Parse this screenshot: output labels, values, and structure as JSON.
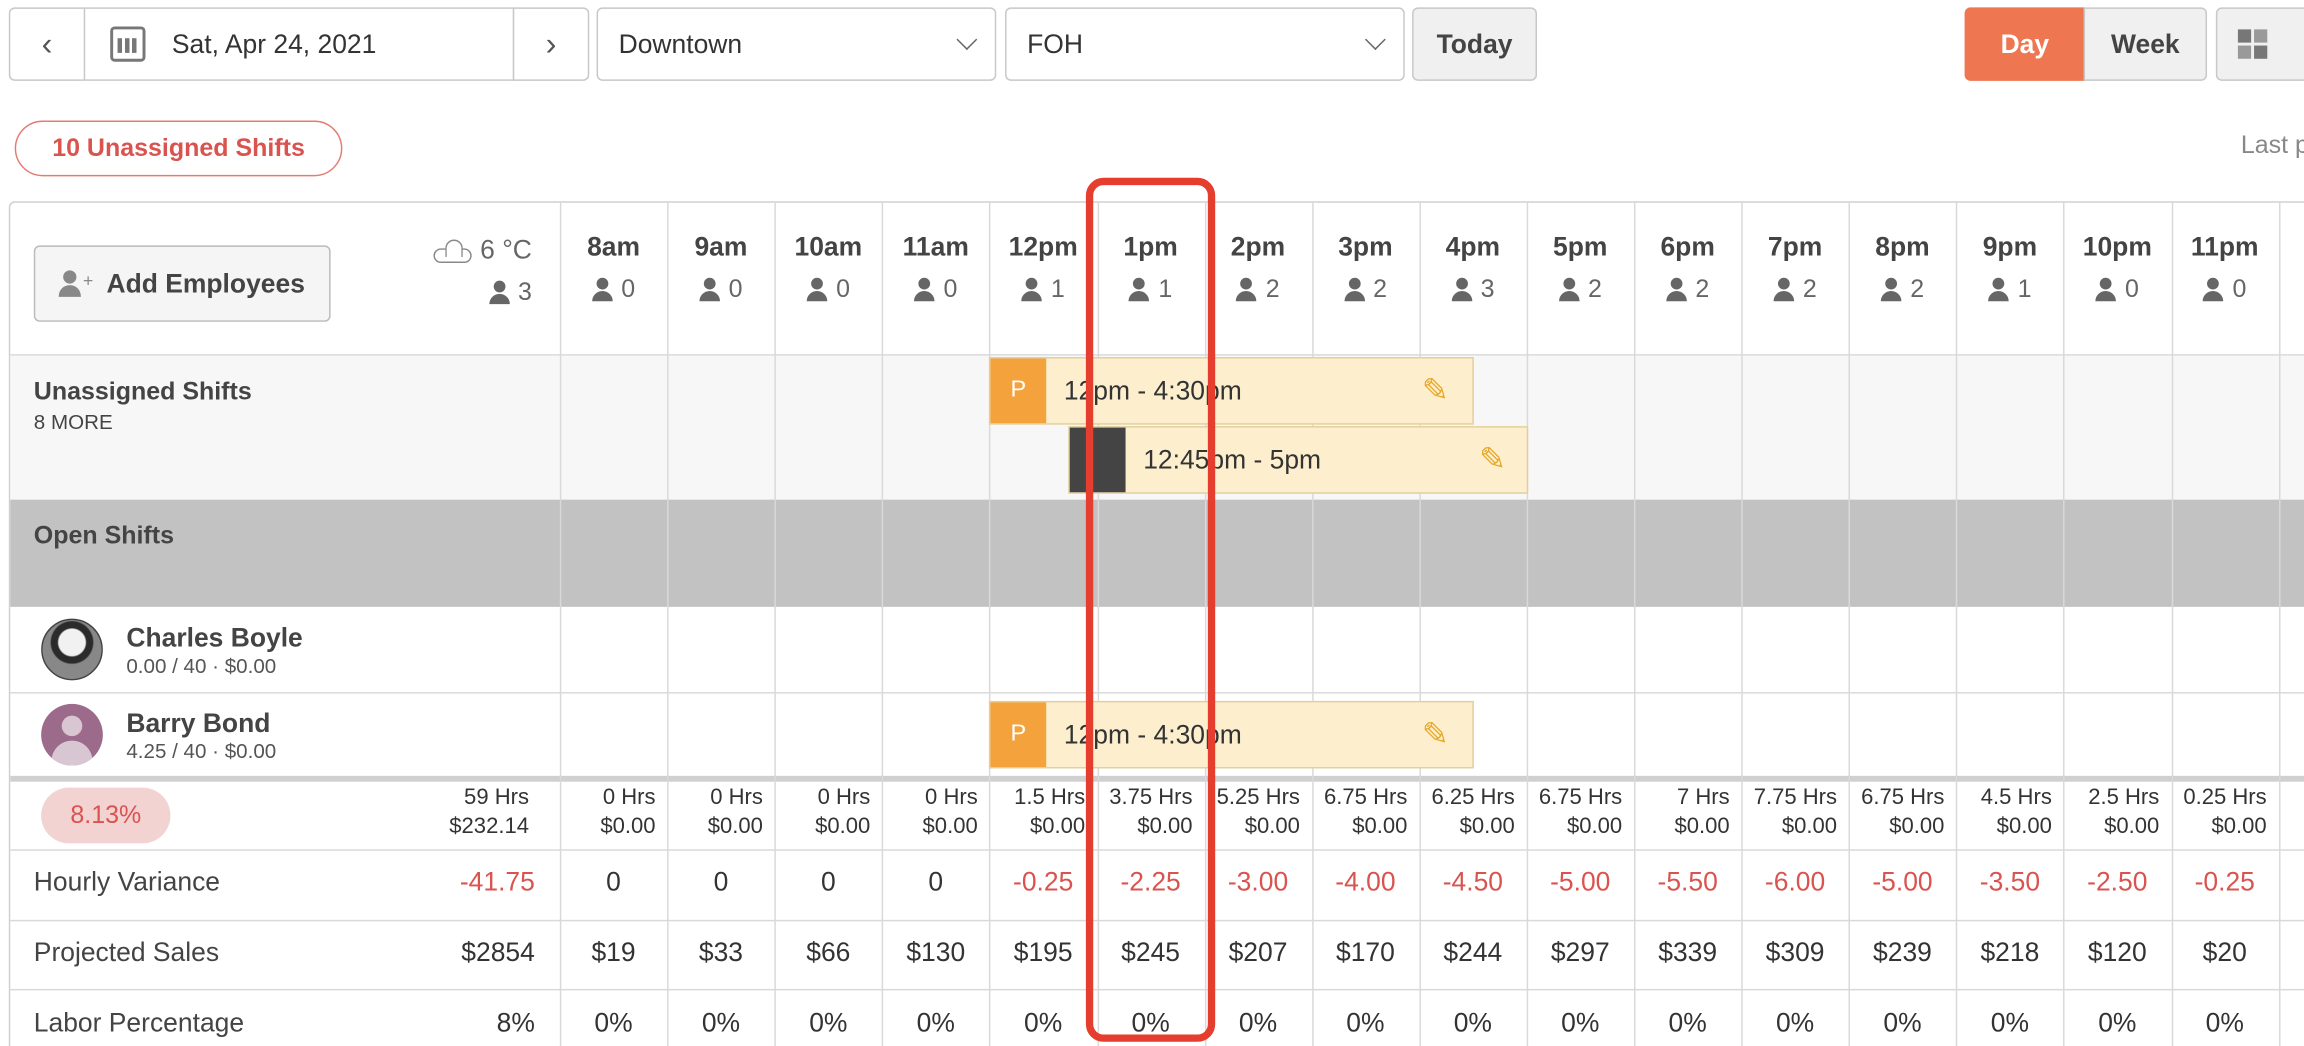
{
  "toolbar": {
    "date": "Sat, Apr 24, 2021",
    "location": "Downtown",
    "department": "FOH",
    "today": "Today",
    "view_day": "Day",
    "view_week": "Week",
    "last_label": "Last p"
  },
  "unassigned_badge": "10 Unassigned Shifts",
  "add_employees": "Add Employees",
  "weather": {
    "temp": "6 °C",
    "count": "3"
  },
  "hours": [
    {
      "label": "8am",
      "count": "0"
    },
    {
      "label": "9am",
      "count": "0"
    },
    {
      "label": "10am",
      "count": "0"
    },
    {
      "label": "11am",
      "count": "0"
    },
    {
      "label": "12pm",
      "count": "1"
    },
    {
      "label": "1pm",
      "count": "1"
    },
    {
      "label": "2pm",
      "count": "2"
    },
    {
      "label": "3pm",
      "count": "2"
    },
    {
      "label": "4pm",
      "count": "3"
    },
    {
      "label": "5pm",
      "count": "2"
    },
    {
      "label": "6pm",
      "count": "2"
    },
    {
      "label": "7pm",
      "count": "2"
    },
    {
      "label": "8pm",
      "count": "2"
    },
    {
      "label": "9pm",
      "count": "1"
    },
    {
      "label": "10pm",
      "count": "0"
    },
    {
      "label": "11pm",
      "count": "0"
    }
  ],
  "rows": {
    "unassigned_title": "Unassigned Shifts",
    "unassigned_more": "8 MORE",
    "open_shifts": "Open Shifts",
    "emp1_name": "Charles Boyle",
    "emp1_sub": "0.00 / 40 · $0.00",
    "emp2_name": "Barry Bond",
    "emp2_sub": "4.25 / 40 · $0.00"
  },
  "shifts": {
    "s1": {
      "tag": "P",
      "time": "12pm - 4:30pm"
    },
    "s2": {
      "tag": "",
      "time": "12:45pm - 5pm"
    },
    "s3": {
      "tag": "P",
      "time": "12pm - 4:30pm"
    }
  },
  "summary": {
    "labor_pct_badge": "8.13%",
    "total_hrs": "59 Hrs",
    "total_cost": "$232.14",
    "hrs": [
      "0 Hrs",
      "0 Hrs",
      "0 Hrs",
      "0 Hrs",
      "1.5 Hrs",
      "3.75 Hrs",
      "5.25 Hrs",
      "6.75 Hrs",
      "6.25 Hrs",
      "6.75 Hrs",
      "7 Hrs",
      "7.75 Hrs",
      "6.75 Hrs",
      "4.5 Hrs",
      "2.5 Hrs",
      "0.25 Hrs"
    ],
    "cost": [
      "$0.00",
      "$0.00",
      "$0.00",
      "$0.00",
      "$0.00",
      "$0.00",
      "$0.00",
      "$0.00",
      "$0.00",
      "$0.00",
      "$0.00",
      "$0.00",
      "$0.00",
      "$0.00",
      "$0.00",
      "$0.00"
    ]
  },
  "hourly_variance": {
    "label": "Hourly Variance",
    "total": "-41.75",
    "values": [
      "0",
      "0",
      "0",
      "0",
      "-0.25",
      "-2.25",
      "-3.00",
      "-4.00",
      "-4.50",
      "-5.00",
      "-5.50",
      "-6.00",
      "-5.00",
      "-3.50",
      "-2.50",
      "-0.25"
    ]
  },
  "projected_sales": {
    "label": "Projected Sales",
    "total": "$2854",
    "values": [
      "$19",
      "$33",
      "$66",
      "$130",
      "$195",
      "$245",
      "$207",
      "$170",
      "$244",
      "$297",
      "$339",
      "$309",
      "$239",
      "$218",
      "$120",
      "$20"
    ]
  },
  "labor_percentage": {
    "label": "Labor Percentage",
    "total": "8%",
    "values": [
      "0%",
      "0%",
      "0%",
      "0%",
      "0%",
      "0%",
      "0%",
      "0%",
      "0%",
      "0%",
      "0%",
      "0%",
      "0%",
      "0%",
      "0%",
      "0%"
    ]
  },
  "colors": {
    "accent": "#ee7650",
    "badge_red": "#d9534f",
    "shift_bg": "#fdefcd",
    "tag_orange": "#f3a23c",
    "open_gray": "#c2c2c2",
    "highlight": "#e53e2e"
  }
}
